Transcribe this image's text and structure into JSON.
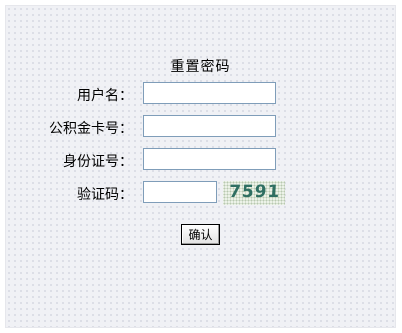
{
  "form": {
    "title": "重置密码",
    "fields": [
      {
        "label": "用户名：",
        "value": ""
      },
      {
        "label": "公积金卡号：",
        "value": ""
      },
      {
        "label": "身份证号：",
        "value": ""
      },
      {
        "label": "验证码：",
        "value": ""
      }
    ],
    "captcha_text": "7591",
    "confirm_label": "确认"
  }
}
